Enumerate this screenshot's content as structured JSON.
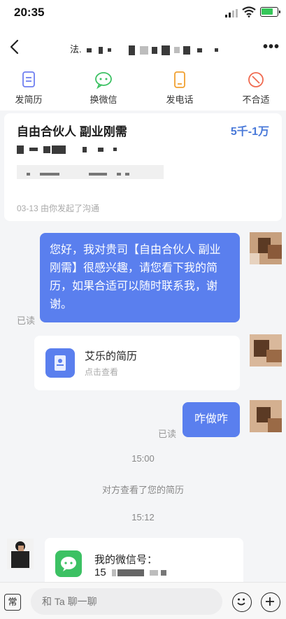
{
  "status_bar": {
    "time": "20:35"
  },
  "header": {
    "title_prefix": "法.",
    "more_icon": "more-icon"
  },
  "actions": [
    {
      "label": "发简历",
      "icon": "resume-icon",
      "color": "#6f7ff0"
    },
    {
      "label": "换微信",
      "icon": "wechat-icon",
      "color": "#3cc163"
    },
    {
      "label": "发电话",
      "icon": "phone-icon",
      "color": "#f0a030"
    },
    {
      "label": "不合适",
      "icon": "not-suitable-icon",
      "color": "#f06a50"
    }
  ],
  "job": {
    "title": "自由合伙人  副业刚需",
    "salary": "5千-1万",
    "date_line": "03-13   由你发起了沟通"
  },
  "messages": {
    "msg1": "您好，我对贵司【自由合伙人 副业刚需】很感兴趣，请您看下我的简历，如果合适可以随时联系我，谢谢。",
    "read1": "已读",
    "resume_title": "艾乐的简历",
    "resume_sub": "点击查看",
    "msg2": "咋做咋",
    "read2": "已读",
    "time1": "15:00",
    "notice": "对方查看了您的简历",
    "time2": "15:12",
    "wechat_title": "我的微信号：",
    "wechat_prefix": "15"
  },
  "bottom": {
    "common_label": "常",
    "input_placeholder": "和 Ta 聊一聊",
    "emoji_icon": "emoji-icon",
    "plus_icon": "plus-icon"
  },
  "colors": {
    "accent": "#5a7fee",
    "salary": "#4a7ad9",
    "wechat": "#3cc163"
  }
}
